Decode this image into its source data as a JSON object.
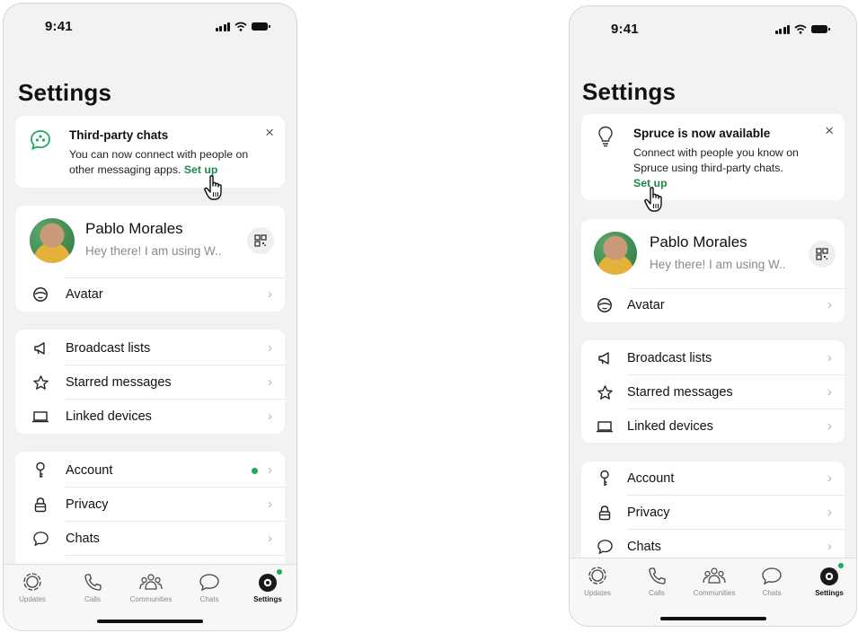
{
  "left": {
    "status_time": "9:41",
    "title": "Settings",
    "banner": {
      "icon": "third-party-chat-icon",
      "title": "Third-party chats",
      "body": "You can now connect with people on other messaging apps.",
      "link": "Set up",
      "close": "×"
    },
    "profile": {
      "name": "Pablo Morales",
      "status": "Hey there! I am using W.."
    },
    "avatar_row": {
      "label": "Avatar"
    },
    "group1": [
      {
        "label": "Broadcast lists",
        "icon": "megaphone-icon"
      },
      {
        "label": "Starred messages",
        "icon": "star-icon"
      },
      {
        "label": "Linked devices",
        "icon": "laptop-icon"
      }
    ],
    "group2": [
      {
        "label": "Account",
        "icon": "key-icon"
      },
      {
        "label": "Privacy",
        "icon": "lock-icon"
      },
      {
        "label": "Chats",
        "icon": "chat-bubble-icon"
      }
    ]
  },
  "right": {
    "status_time": "9:41",
    "title": "Settings",
    "banner": {
      "icon": "lightbulb-icon",
      "title": "Spruce is now available",
      "body": "Connect with people you know on Spruce using third-party chats.",
      "link": "Set up",
      "close": "×"
    },
    "profile": {
      "name": "Pablo Morales",
      "status": "Hey there! I am using W.."
    },
    "avatar_row": {
      "label": "Avatar"
    },
    "group1": [
      {
        "label": "Broadcast lists",
        "icon": "megaphone-icon"
      },
      {
        "label": "Starred messages",
        "icon": "star-icon"
      },
      {
        "label": "Linked devices",
        "icon": "laptop-icon"
      }
    ],
    "group2": [
      {
        "label": "Account",
        "icon": "key-icon"
      },
      {
        "label": "Privacy",
        "icon": "lock-icon"
      },
      {
        "label": "Chats",
        "icon": "chat-bubble-icon"
      }
    ]
  },
  "tabs": [
    {
      "label": "Updates",
      "icon": "updates-icon"
    },
    {
      "label": "Calls",
      "icon": "phone-icon"
    },
    {
      "label": "Communities",
      "icon": "communities-icon"
    },
    {
      "label": "Chats",
      "icon": "chats-icon"
    },
    {
      "label": "Settings",
      "icon": "settings-icon",
      "active": true
    }
  ],
  "colors": {
    "accent_green": "#1daa61",
    "link_green": "#1d8a4e",
    "background": "#f2f2f3"
  }
}
